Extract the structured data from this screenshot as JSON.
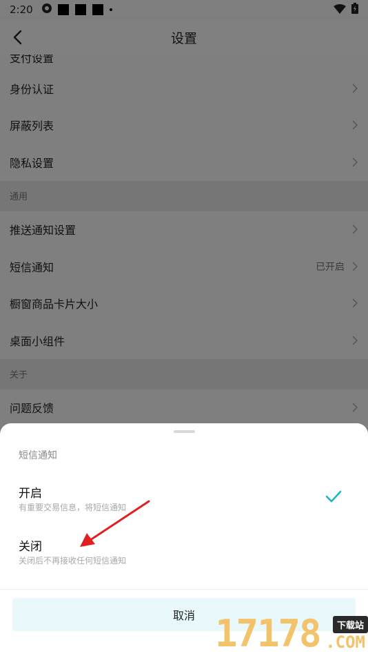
{
  "status_bar": {
    "time": "2:20"
  },
  "header": {
    "title": "设置"
  },
  "settings": {
    "partial_row": "支付设置",
    "rows_group1": [
      {
        "label": "身份认证"
      },
      {
        "label": "屏蔽列表"
      },
      {
        "label": "隐私设置"
      }
    ],
    "section_general": "通用",
    "rows_group2": [
      {
        "label": "推送通知设置",
        "value": ""
      },
      {
        "label": "短信通知",
        "value": "已开启"
      },
      {
        "label": "橱窗商品卡片大小",
        "value": ""
      },
      {
        "label": "桌面小组件",
        "value": ""
      }
    ],
    "section_about": "关于",
    "rows_group3": [
      {
        "label": "问题反馈"
      }
    ]
  },
  "sheet": {
    "title": "短信通知",
    "options": [
      {
        "label": "开启",
        "desc": "有重要交易信息，将短信通知",
        "selected": true
      },
      {
        "label": "关闭",
        "desc": "关闭后不再接收任何短信通知",
        "selected": false
      }
    ],
    "cancel_label": "取消"
  },
  "colors": {
    "accent": "#1cb5c8",
    "annotation_arrow": "#e02020",
    "cancel_bg": "#e8f8fb",
    "dim_overlay": "#7f7f7f"
  },
  "watermark": {
    "digits": "17178",
    "badge": "下载站",
    "domain": ".COM"
  }
}
